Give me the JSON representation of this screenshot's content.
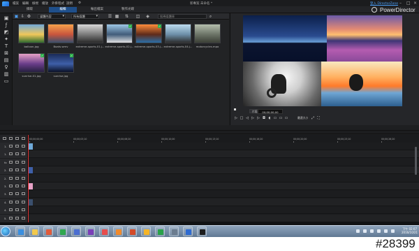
{
  "menu": {
    "items": [
      "檔案",
      "編輯",
      "檢視",
      "播放",
      "外掛程式",
      "說明"
    ],
    "title": "新專案  未命名 *",
    "user": "登入 DirectorZone"
  },
  "modes": [
    {
      "label": "擷取",
      "active": false
    },
    {
      "label": "編輯",
      "active": true
    },
    {
      "label": "輸出檔案",
      "active": false
    },
    {
      "label": "製作光碟",
      "active": false
    }
  ],
  "brand": "PowerDirector",
  "library": {
    "filter": "媒體內容",
    "sort": "所有媒體",
    "search_placeholder": "搜尋媒體庫",
    "items": [
      {
        "label": "balloon.jpg",
        "colors": [
          "#6fa9d8",
          "#f0c75a",
          "#2e6a2e"
        ],
        "checked": false
      },
      {
        "label": "Boats.wmv",
        "colors": [
          "#f7a24b",
          "#c8553d",
          "#3a4f6d"
        ],
        "checked": false
      },
      {
        "label": "extreme-sports-01.j...",
        "colors": [
          "#d9d9d9",
          "#7a7a7a",
          "#2a2a2a"
        ],
        "checked": false
      },
      {
        "label": "extreme-sports-02.j...",
        "colors": [
          "#9dc7e6",
          "#415c7a",
          "#e2e2e2"
        ],
        "checked": true
      },
      {
        "label": "extreme-sports-03.j...",
        "colors": [
          "#ff8c3a",
          "#5f2b1a",
          "#2a6fa8"
        ],
        "checked": true
      },
      {
        "label": "extreme-sports-04.j...",
        "colors": [
          "#bcdcf0",
          "#6d8fa8",
          "#2d2d2d"
        ],
        "checked": false
      },
      {
        "label": "motorcycles.mpo",
        "colors": [
          "#b5bfae",
          "#6c7467",
          "#3b3f36"
        ],
        "checked": false
      },
      {
        "label": "sunrise-01.jpg",
        "colors": [
          "#e7a1c7",
          "#6a3d8a",
          "#26203f"
        ],
        "checked": true
      },
      {
        "label": "sunrise.jpg",
        "colors": [
          "#1a2b57",
          "#3e5fa8",
          "#0b1126"
        ],
        "checked": true
      }
    ]
  },
  "preview": {
    "tab_clip": "片段",
    "tab_movie": "影片",
    "timecode": "00;00;00;00",
    "fit": "最適大小"
  },
  "timeline": {
    "ticks": [
      "00;00;00;00",
      "00;00;03;10",
      "00;00;06;20",
      "00;00;10;00",
      "00;00;13;10",
      "00;00;16;20",
      "00;00;20;00",
      "00;00;23;10",
      "00;00;26;20"
    ],
    "tracks": [
      {
        "label": "1.",
        "clip": "#6fa9d8"
      },
      {
        "label": "1.",
        "clip": ""
      },
      {
        "label": "fx",
        "clip": ""
      },
      {
        "label": "2.",
        "clip": "#3e5fa8"
      },
      {
        "label": "2.",
        "clip": ""
      },
      {
        "label": "3.",
        "clip": "#e7a1c7"
      },
      {
        "label": "3.",
        "clip": ""
      },
      {
        "label": "4.",
        "clip": "#3a4f6d"
      },
      {
        "label": "4.",
        "clip": ""
      },
      {
        "label": "5.",
        "clip": ""
      }
    ]
  },
  "taskbar": {
    "time": "下午 02:07",
    "date": "2016/10/21",
    "apps": [
      "#3a8fe0",
      "#f2c94c",
      "#e15b3b",
      "#2fa84f",
      "#4b6ed1",
      "#7a3fb8",
      "#e84d4d",
      "#f08a2c",
      "#d44b2a",
      "#f5b528",
      "#29a24a",
      "#6b7c8f",
      "#2e6bd1",
      "#1c1c1c"
    ]
  },
  "watermark": "#28399"
}
